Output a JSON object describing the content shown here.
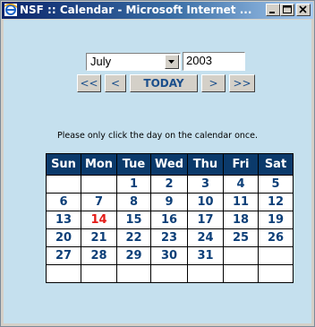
{
  "window": {
    "title": "NSF :: Calendar - Microsoft Internet ..."
  },
  "controls": {
    "month_value": "July",
    "year_value": "2003",
    "nav": {
      "prev_year": "<<",
      "prev_month": "<",
      "today": "TODAY",
      "next_month": ">",
      "next_year": ">>"
    }
  },
  "notice": "Please only click the day on the calendar once.",
  "calendar": {
    "headers": [
      "Sun",
      "Mon",
      "Tue",
      "Wed",
      "Thu",
      "Fri",
      "Sat"
    ],
    "today": "14",
    "colors": {
      "header_bg": "#0b3a6b",
      "day_text": "#0d3f78",
      "today_text": "#e41b17",
      "page_bg": "#c5e0ee"
    },
    "weeks": [
      [
        "",
        "",
        "1",
        "2",
        "3",
        "4",
        "5"
      ],
      [
        "6",
        "7",
        "8",
        "9",
        "10",
        "11",
        "12"
      ],
      [
        "13",
        "14",
        "15",
        "16",
        "17",
        "18",
        "19"
      ],
      [
        "20",
        "21",
        "22",
        "23",
        "24",
        "25",
        "26"
      ],
      [
        "27",
        "28",
        "29",
        "30",
        "31",
        "",
        ""
      ],
      [
        "",
        "",
        "",
        "",
        "",
        "",
        ""
      ]
    ]
  }
}
